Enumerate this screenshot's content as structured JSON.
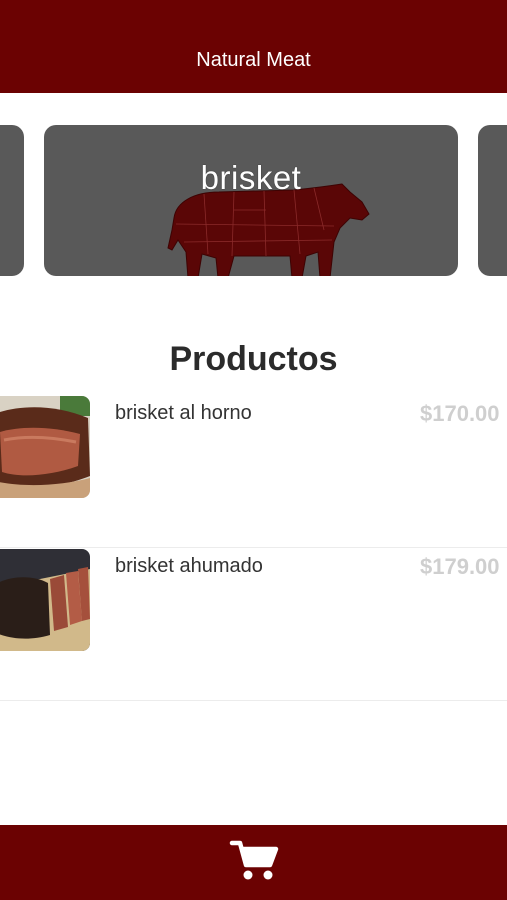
{
  "header": {
    "title": "Natural Meat"
  },
  "carousel": {
    "active_category": "brisket",
    "icon": "beef-cuts-silhouette"
  },
  "products_section": {
    "title": "Productos"
  },
  "products": [
    {
      "name": "brisket al horno",
      "price": "$170.00",
      "image": "oven-brisket-photo"
    },
    {
      "name": "brisket ahumado",
      "price": "$179.00",
      "image": "smoked-brisket-photo"
    }
  ],
  "bottom_nav": {
    "icon": "cart-icon"
  },
  "colors": {
    "brand": "#6b0202",
    "card": "#595959",
    "price": "#cfcfcf"
  }
}
